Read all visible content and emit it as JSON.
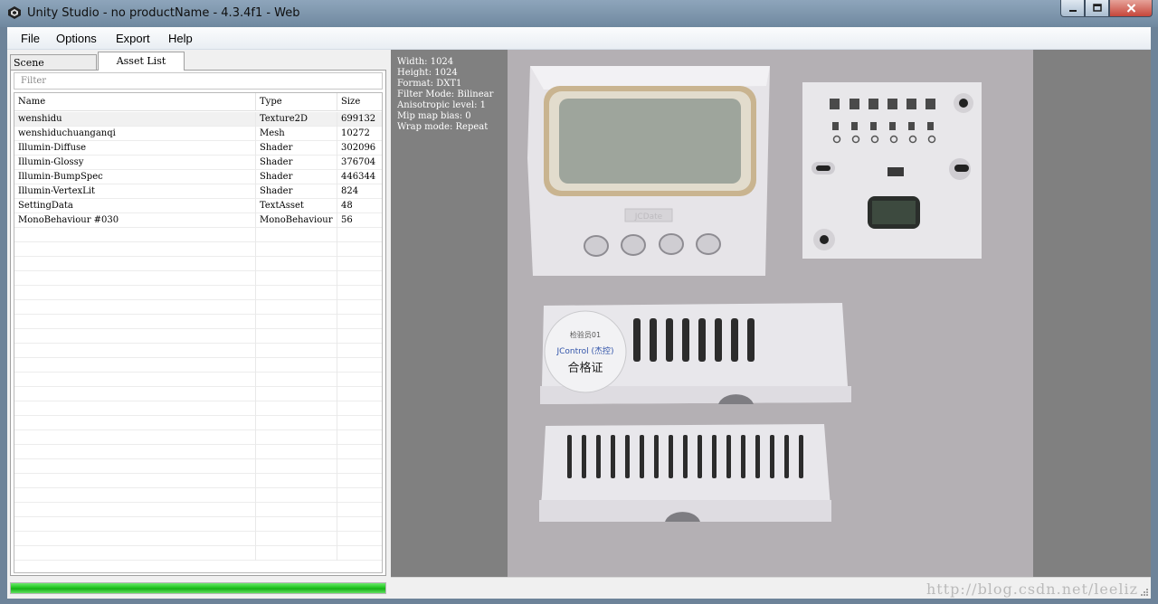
{
  "window": {
    "title": "Unity Studio - no productName - 4.3.4f1 - Web"
  },
  "menu": [
    "File",
    "Options",
    "Export",
    "Help"
  ],
  "tabs": {
    "scene": "Scene Hierarchy",
    "assets": "Asset List"
  },
  "filter": {
    "placeholder": "Filter"
  },
  "table": {
    "headers": [
      "Name",
      "Type",
      "Size"
    ],
    "rows": [
      [
        "wenshidu",
        "Texture2D",
        "699132"
      ],
      [
        "wenshiduchuanganqi",
        "Mesh",
        "10272"
      ],
      [
        "Illumin-Diffuse",
        "Shader",
        "302096"
      ],
      [
        "Illumin-Glossy",
        "Shader",
        "376704"
      ],
      [
        "Illumin-BumpSpec",
        "Shader",
        "446344"
      ],
      [
        "Illumin-VertexLit",
        "Shader",
        "824"
      ],
      [
        "SettingData",
        "TextAsset",
        "48"
      ],
      [
        "MonoBehaviour #030",
        "MonoBehaviour",
        "56"
      ]
    ]
  },
  "progress": {
    "value": 1.0,
    "color": "#22c622"
  },
  "texture_info": [
    "Width: 1024",
    "Height: 1024",
    "Format: DXT1",
    "Filter Mode: Bilinear",
    "Anisotropic level: 1",
    "Mip map bias: 0",
    "Wrap mode: Repeat"
  ],
  "texture_labels": {
    "lcd_brand": "JCDate",
    "sticker_cert": "合格证",
    "sticker_brand": "JControl (杰控)",
    "sticker_line": "检验员01"
  },
  "watermark": "http://blog.csdn.net/leeliz",
  "icons": {
    "app": "unity-logo-icon",
    "minimize": "minimize-icon",
    "maximize": "maximize-icon",
    "close": "close-icon",
    "grip": "resize-grip-icon"
  },
  "colors": {
    "preview_bg": "#808080",
    "texture_bg": "#b4b0b4",
    "title_bar": "#7e96ad"
  }
}
